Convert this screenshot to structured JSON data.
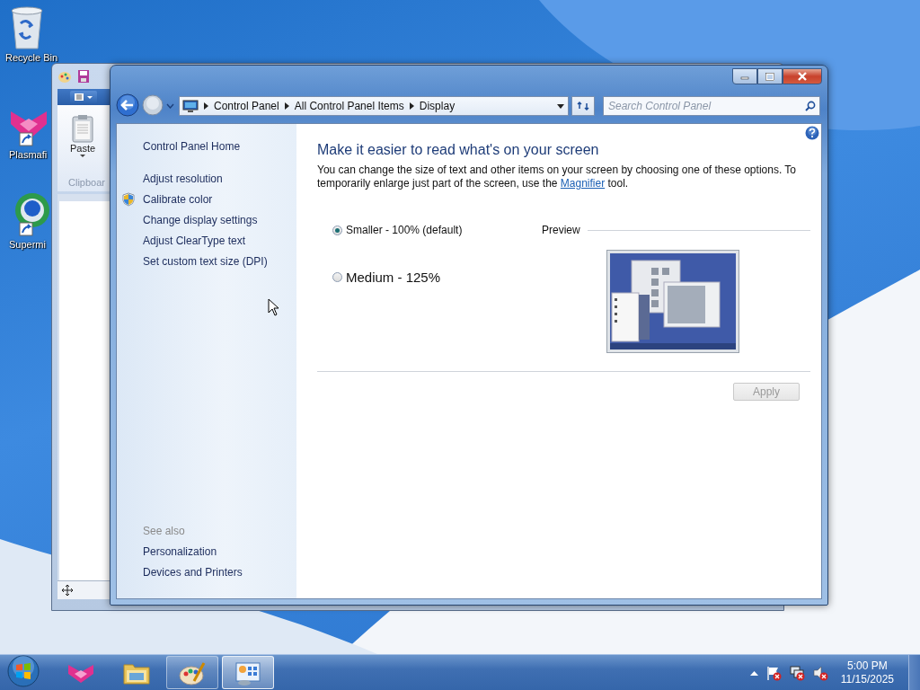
{
  "desktop_icons": [
    {
      "kind": "recycle-bin",
      "label": "Recycle Bin"
    },
    {
      "kind": "plasma",
      "label": "Plasmafi"
    },
    {
      "kind": "globe",
      "label": "Supermi"
    }
  ],
  "background_window": {
    "paste_label": "Paste",
    "group_label": "Clipboar"
  },
  "window": {
    "breadcrumb": [
      "Control Panel",
      "All Control Panel Items",
      "Display"
    ],
    "search": {
      "placeholder": "Search Control Panel"
    },
    "sidebar": {
      "home": "Control Panel Home",
      "tasks": [
        {
          "label": "Adjust resolution",
          "shield": false
        },
        {
          "label": "Calibrate color",
          "shield": true
        },
        {
          "label": "Change display settings",
          "shield": false
        },
        {
          "label": "Adjust ClearType text",
          "shield": false
        },
        {
          "label": "Set custom text size (DPI)",
          "shield": false
        }
      ],
      "see_also": {
        "heading": "See also",
        "items": [
          "Personalization",
          "Devices and Printers"
        ]
      }
    },
    "content": {
      "heading": "Make it easier to read what's on your screen",
      "description": {
        "before": "You can change the size of text and other items on your screen by choosing one of these options. To temporarily enlarge just part of the screen, use the ",
        "link": "Magnifier",
        "after": " tool."
      },
      "options": [
        {
          "label": "Smaller - 100% (default)",
          "kind": "small",
          "selected": true
        },
        {
          "label": "Medium - 125%",
          "kind": "medium",
          "selected": false
        }
      ],
      "preview_label": "Preview",
      "apply_button": {
        "label": "Apply",
        "disabled": true
      }
    }
  },
  "taskbar": {
    "apps": [
      {
        "kind": "plasma",
        "running": false,
        "selected": false
      },
      {
        "kind": "folder",
        "running": false,
        "selected": false
      },
      {
        "kind": "paint",
        "running": true,
        "selected": false
      },
      {
        "kind": "display",
        "running": true,
        "selected": true
      }
    ],
    "tray": {
      "time": "5:00 PM",
      "date": "11/15/2025"
    }
  }
}
